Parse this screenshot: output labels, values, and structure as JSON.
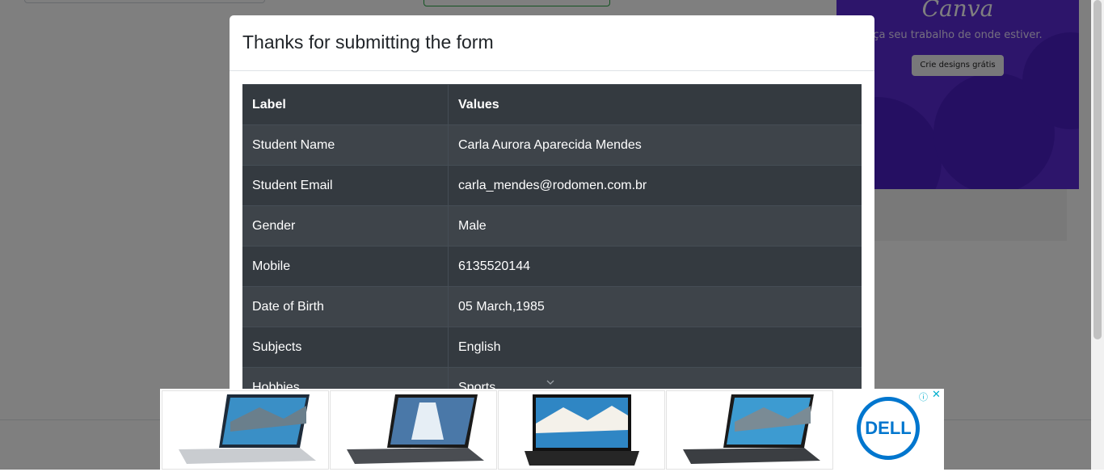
{
  "modal": {
    "title": "Thanks for submitting the form",
    "table": {
      "headers": [
        "Label",
        "Values"
      ],
      "rows": [
        [
          "Student Name",
          "Carla Aurora Aparecida Mendes"
        ],
        [
          "Student Email",
          "carla_mendes@rodomen.com.br"
        ],
        [
          "Gender",
          "Male"
        ],
        [
          "Mobile",
          "6135520144"
        ],
        [
          "Date of Birth",
          "05 March,1985"
        ],
        [
          "Subjects",
          "English"
        ],
        [
          "Hobbies",
          "Sports"
        ]
      ]
    }
  },
  "side_ad": {
    "brand": "Canva",
    "tagline": "ça seu trabalho de onde estiver.",
    "button": "Crie designs grátis"
  },
  "bottom_ad": {
    "brand": "DELL",
    "info_icon": "ⓘ",
    "close_icon": "✕"
  },
  "colors": {
    "table_dark": "#343a40",
    "canva_purple": "#5b2bd6",
    "dell_blue": "#0076ce"
  }
}
